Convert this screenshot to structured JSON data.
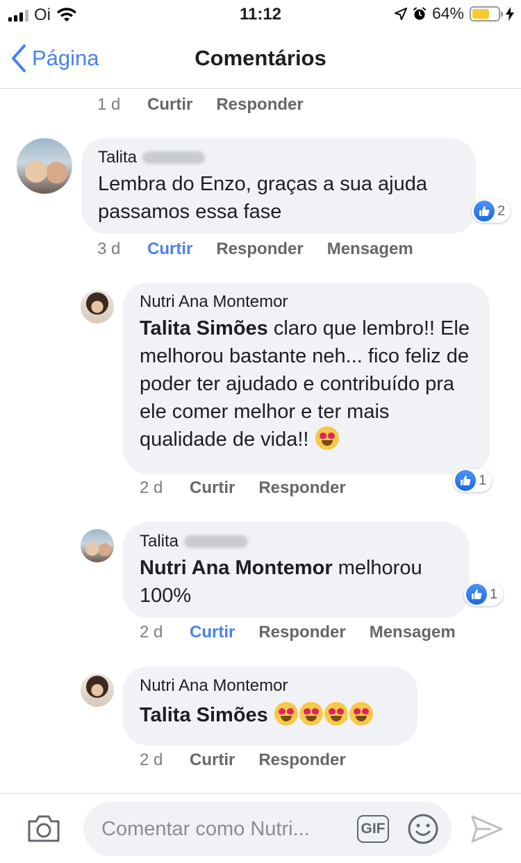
{
  "status_bar": {
    "carrier": "Oi",
    "time": "11:12",
    "battery": "64%",
    "battery_level": 0.64
  },
  "nav": {
    "back_label": "Página",
    "title": "Comentários"
  },
  "comments": [
    {
      "meta": {
        "time": "1 d",
        "like": "Curtir",
        "reply": "Responder"
      }
    },
    {
      "author": "Talita",
      "text": "Lembra do Enzo, graças a sua ajuda passamos essa fase",
      "reaction_count": "2",
      "meta": {
        "time": "3 d",
        "like": "Curtir",
        "reply": "Responder",
        "message": "Mensagem"
      }
    },
    {
      "author": "Nutri Ana Montemor",
      "mention": "Talita Simões",
      "text": " claro que lembro!! Ele melhorou bastante neh... fico feliz de poder ter ajudado e contribuído pra ele comer melhor e ter mais qualidade de vida!! ",
      "reaction_count": "1",
      "meta": {
        "time": "2 d",
        "like": "Curtir",
        "reply": "Responder"
      }
    },
    {
      "author": "Talita",
      "mention": "Nutri Ana Montemor",
      "text": " melhorou 100%",
      "reaction_count": "1",
      "meta": {
        "time": "2 d",
        "like": "Curtir",
        "reply": "Responder",
        "message": "Mensagem"
      }
    },
    {
      "author": "Nutri Ana Montemor",
      "mention": "Talita Simões",
      "meta": {
        "time": "2 d",
        "like": "Curtir",
        "reply": "Responder"
      }
    }
  ],
  "composer": {
    "placeholder": "Comentar como Nutri...",
    "gif_label": "GIF"
  },
  "colors": {
    "accent": "#4a80f5",
    "bubble": "#f0f2f5",
    "like_blue": "#1b6be0"
  }
}
